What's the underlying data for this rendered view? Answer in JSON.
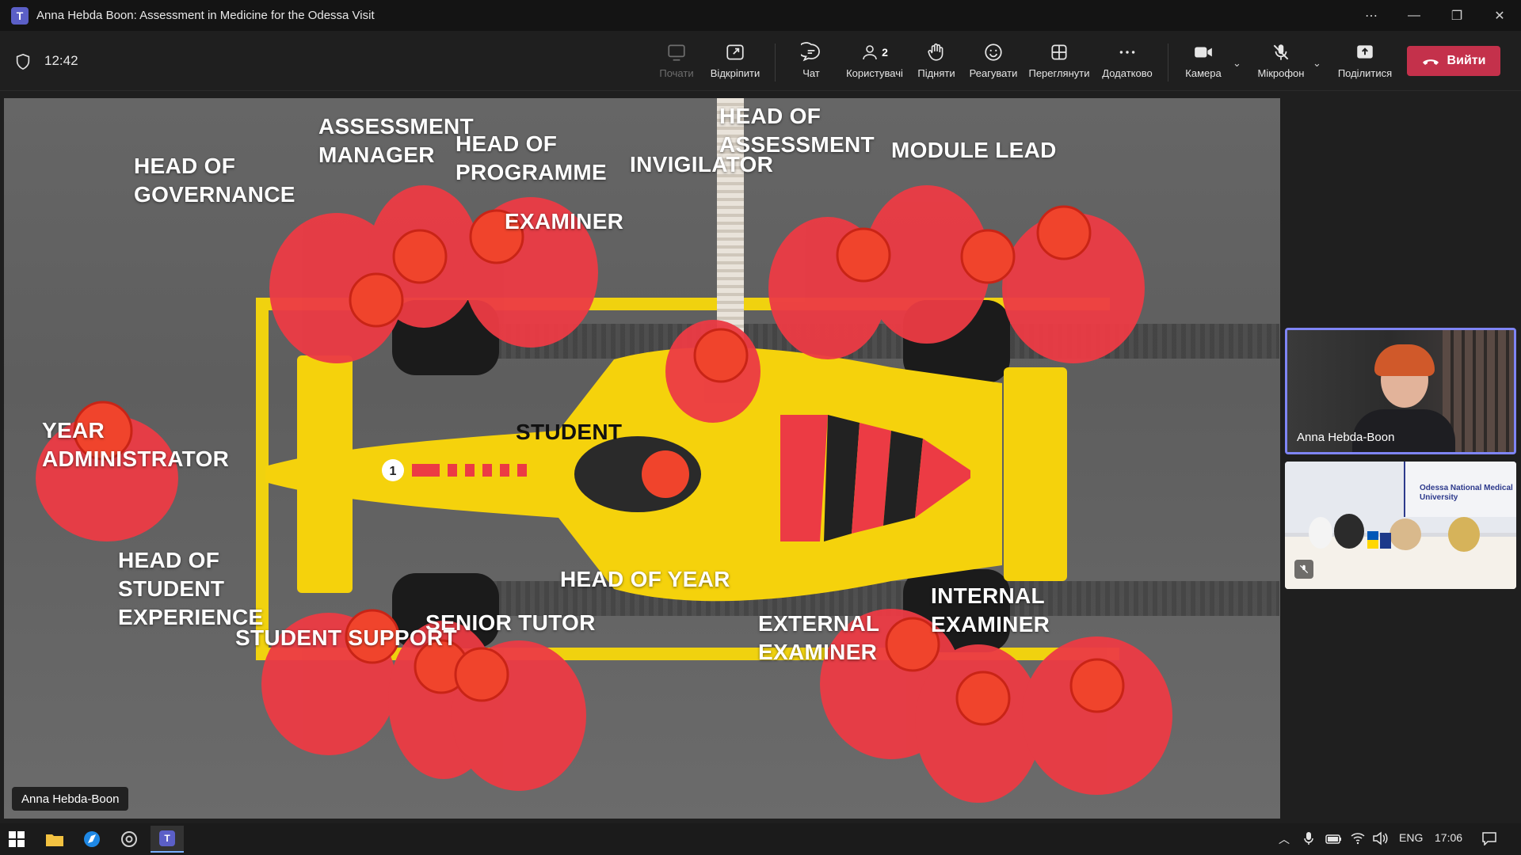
{
  "window": {
    "title": "Anna Hebda Boon: Assessment in Medicine for the Odessa Visit"
  },
  "meeting": {
    "elapsed_time": "12:42",
    "toolbar": {
      "start": "Почати",
      "undock": "Відкріпити",
      "chat": "Чат",
      "people": "Користувачі",
      "people_count": "2",
      "raise": "Підняти",
      "react": "Реагувати",
      "view": "Переглянути",
      "more": "Додатково",
      "camera": "Камера",
      "mic": "Мікрофон",
      "share": "Поділитися",
      "leave": "Вийти"
    },
    "colors": {
      "leave": "#c4314b",
      "active_tile_border": "#7f85f5",
      "teams_accent": "#5b5fc7"
    }
  },
  "slide": {
    "presenter_name": "Anna Hebda-Boon",
    "labels": {
      "assessment_manager": "ASSESSMENT\nMANAGER",
      "head_of_programme": "HEAD OF\nPROGRAMME",
      "head_of_assessment": "HEAD OF\nASSESSMENT",
      "module_lead": "MODULE LEAD",
      "head_of_governance": "HEAD OF\nGOVERNANCE",
      "invigilator": "INVIGILATOR",
      "examiner": "EXAMINER",
      "year_administrator": "YEAR\nADMINISTRATOR",
      "student": "STUDENT",
      "head_of_student_experience": "HEAD OF\nSTUDENT\nEXPERIENCE",
      "head_of_year": "HEAD OF YEAR",
      "internal_examiner": "INTERNAL\nEXAMINER",
      "senior_tutor": "SENIOR TUTOR",
      "external_examiner": "EXTERNAL\nEXAMINER",
      "student_support": "STUDENT SUPPORT"
    },
    "car_number": "1",
    "colors": {
      "car": "#f5d20c",
      "crew": "#ec3b44",
      "helmet": "#f0442c",
      "box_line": "#f0d20f"
    }
  },
  "participants": [
    {
      "name": "Anna Hebda-Boon",
      "active_speaker": true
    },
    {
      "name": "",
      "muted": true,
      "room_sign": "Odessa National Medical University"
    }
  ],
  "taskbar": {
    "language": "ENG",
    "clock": "17:06"
  }
}
